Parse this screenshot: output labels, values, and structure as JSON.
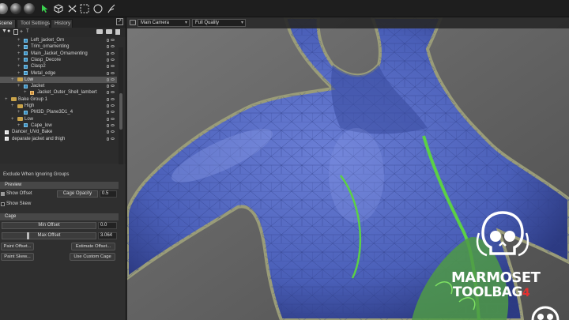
{
  "toolbar": {
    "icons": [
      "sphere-icon",
      "sphere-dark-icon",
      "sphere-dark-icon",
      "select-arrow-icon",
      "cube-icon",
      "transform-icon",
      "marquee-select-icon",
      "lasso-circle-icon",
      "paint-select-icon"
    ]
  },
  "panel": {
    "tabs": [
      "Scene",
      "Tool Settings",
      "History"
    ],
    "active_tab": "Scene",
    "tree": [
      {
        "label": "Left_jacket_Orn",
        "type": "mesh",
        "indent": 3
      },
      {
        "label": "Trim_ornamenting",
        "type": "mesh",
        "indent": 3
      },
      {
        "label": "Main_Jacket_Ornamenting",
        "type": "mesh",
        "indent": 3
      },
      {
        "label": "Clasp_Decore",
        "type": "mesh",
        "indent": 3
      },
      {
        "label": "Clasp2",
        "type": "mesh",
        "indent": 3
      },
      {
        "label": "Metal_edge",
        "type": "mesh",
        "indent": 3
      },
      {
        "label": "Low",
        "type": "folder",
        "indent": 2,
        "selected": true
      },
      {
        "label": "Jacket",
        "type": "mesh",
        "indent": 3
      },
      {
        "label": "Jacket_Outer_Shell_lambert",
        "type": "material",
        "indent": 4
      },
      {
        "label": "Bake Group 1",
        "type": "folder",
        "indent": 1
      },
      {
        "label": "High",
        "type": "folder",
        "indent": 2
      },
      {
        "label": "PM3D_Plane3D1_4",
        "type": "mesh",
        "indent": 3
      },
      {
        "label": "Low",
        "type": "folder",
        "indent": 2
      },
      {
        "label": "Cape_low",
        "type": "mesh",
        "indent": 3
      },
      {
        "label": "Dancer_UVd_Bake",
        "type": "item",
        "indent": 0
      },
      {
        "label": "deparate jacket and thigh",
        "type": "item",
        "indent": 0
      }
    ]
  },
  "properties": {
    "exclude_label": "Exclude When Ignoring Groups",
    "preview_section": "Preview",
    "show_offset_label": "Show Offset",
    "cage_opacity_label": "Cage Opacity",
    "cage_opacity_value": "0.5",
    "show_skew_label": "Show Skew",
    "cage_section": "Cage",
    "min_offset_label": "Min Offset",
    "min_offset_value": "0.0",
    "max_offset_label": "Max Offset",
    "max_offset_value": "3.064",
    "paint_offset_button": "Paint Offset...",
    "estimate_offset_button": "Estimate Offset...",
    "paint_skew_button": "Paint Skew...",
    "use_custom_cage_button": "Use Custom Cage"
  },
  "viewport": {
    "camera": "Main Camera",
    "quality": "Full Quality"
  },
  "logo": {
    "line1": "MARMOSET",
    "line2": "TOOLBAG",
    "version": "4"
  },
  "colors": {
    "mesh_blue": "#4a5fb8",
    "cage_green": "#5bd046",
    "accent_red": "#e53030"
  }
}
